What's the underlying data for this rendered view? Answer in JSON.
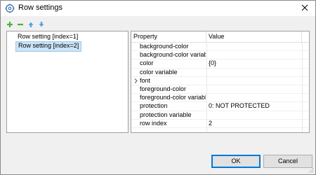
{
  "window": {
    "title": "Row settings",
    "icon": "gear-cog-icon",
    "close_icon": "close-icon"
  },
  "toolbar": {
    "buttons": [
      {
        "name": "add-icon",
        "glyph": "+",
        "color": "#4caf3a"
      },
      {
        "name": "remove-icon",
        "glyph": "−",
        "color": "#4caf3a"
      },
      {
        "name": "move-up-icon",
        "glyph": "▲",
        "color": "#3a8ee6"
      },
      {
        "name": "move-down-icon",
        "glyph": "▼",
        "color": "#3a8ee6"
      }
    ]
  },
  "rows_list": {
    "items": [
      {
        "label": "Row setting [index=1]",
        "selected": false
      },
      {
        "label": "Row setting [index=2]",
        "selected": true
      }
    ]
  },
  "properties": {
    "header": {
      "property": "Property",
      "value": "Value"
    },
    "rows": [
      {
        "property": "background-color",
        "value": "",
        "expandable": false
      },
      {
        "property": "background-color variable",
        "value": "",
        "expandable": false
      },
      {
        "property": "color",
        "value": "{0}",
        "expandable": false
      },
      {
        "property": "color variable",
        "value": "",
        "expandable": false
      },
      {
        "property": "font",
        "value": "",
        "expandable": true
      },
      {
        "property": "foreground-color",
        "value": "",
        "expandable": false
      },
      {
        "property": "foreground-color variable",
        "value": "",
        "expandable": false
      },
      {
        "property": "protection",
        "value": "0: NOT PROTECTED",
        "expandable": false
      },
      {
        "property": "protection variable",
        "value": "",
        "expandable": false
      },
      {
        "property": "row index",
        "value": "2",
        "expandable": false
      }
    ]
  },
  "buttons": {
    "ok": "OK",
    "cancel": "Cancel"
  },
  "colors": {
    "selection": "#cce4f7",
    "default_button_border": "#0078d7"
  }
}
